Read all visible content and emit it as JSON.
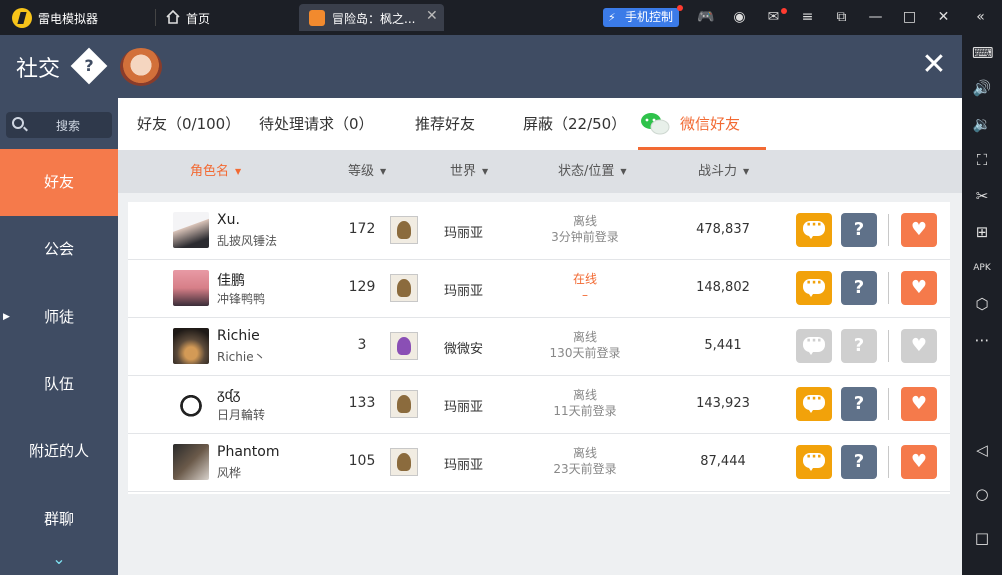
{
  "titlebar": {
    "app_name": "雷电模拟器",
    "home_label": "首页",
    "tab_label": "冒险岛：枫之...",
    "phone_control_label": "手机控制",
    "close_tab_glyph": "✕"
  },
  "header": {
    "title": "社交",
    "help_glyph": "?",
    "close_glyph": "✕"
  },
  "sidebar": {
    "search_label": "搜索",
    "items": [
      {
        "label": "好友",
        "active": true
      },
      {
        "label": "公会"
      },
      {
        "label": "师徒"
      },
      {
        "label": "队伍"
      },
      {
        "label": "附近的人"
      },
      {
        "label": "群聊"
      }
    ]
  },
  "tabs": [
    {
      "label": "好友（0/100）"
    },
    {
      "label": "待处理请求（0）"
    },
    {
      "label": "推荐好友"
    },
    {
      "label": "屏蔽（22/50）"
    },
    {
      "label": "微信好友",
      "active": true
    }
  ],
  "columns": [
    {
      "label": "角色名",
      "sorted": true
    },
    {
      "label": "等级"
    },
    {
      "label": "世界"
    },
    {
      "label": "状态/位置"
    },
    {
      "label": "战斗力"
    }
  ],
  "rows": [
    {
      "name": "Xu.",
      "guild": "乱披风锤法",
      "level": "172",
      "world": "玛丽亚",
      "status": "离线",
      "status_detail": "3分钟前登录",
      "power": "478,837",
      "enabled": true
    },
    {
      "name": "佳鹏",
      "guild": "冲锋鸭鸭",
      "level": "129",
      "world": "玛丽亚",
      "status": "在线",
      "status_detail": "–",
      "power": "148,802",
      "enabled": true,
      "online": true
    },
    {
      "name": "Richie",
      "guild": "Richie丶",
      "level": "3",
      "world": "微微安",
      "status": "离线",
      "status_detail": "130天前登录",
      "power": "5,441",
      "enabled": false
    },
    {
      "name": "ᵹᶑᵹ",
      "guild": "日月輪转",
      "level": "133",
      "world": "玛丽亚",
      "status": "离线",
      "status_detail": "11天前登录",
      "power": "143,923",
      "enabled": true
    },
    {
      "name": "Phantom",
      "guild": "风桦",
      "level": "105",
      "world": "玛丽亚",
      "status": "离线",
      "status_detail": "23天前登录",
      "power": "87,444",
      "enabled": true
    }
  ],
  "colors": {
    "accent": "#f26a33",
    "chat_button": "#f2a20a",
    "help_button": "#5f7189",
    "heart_button": "#f57a4b",
    "disabled_button": "#cfcfcf",
    "nav_background": "#3f4c63"
  }
}
